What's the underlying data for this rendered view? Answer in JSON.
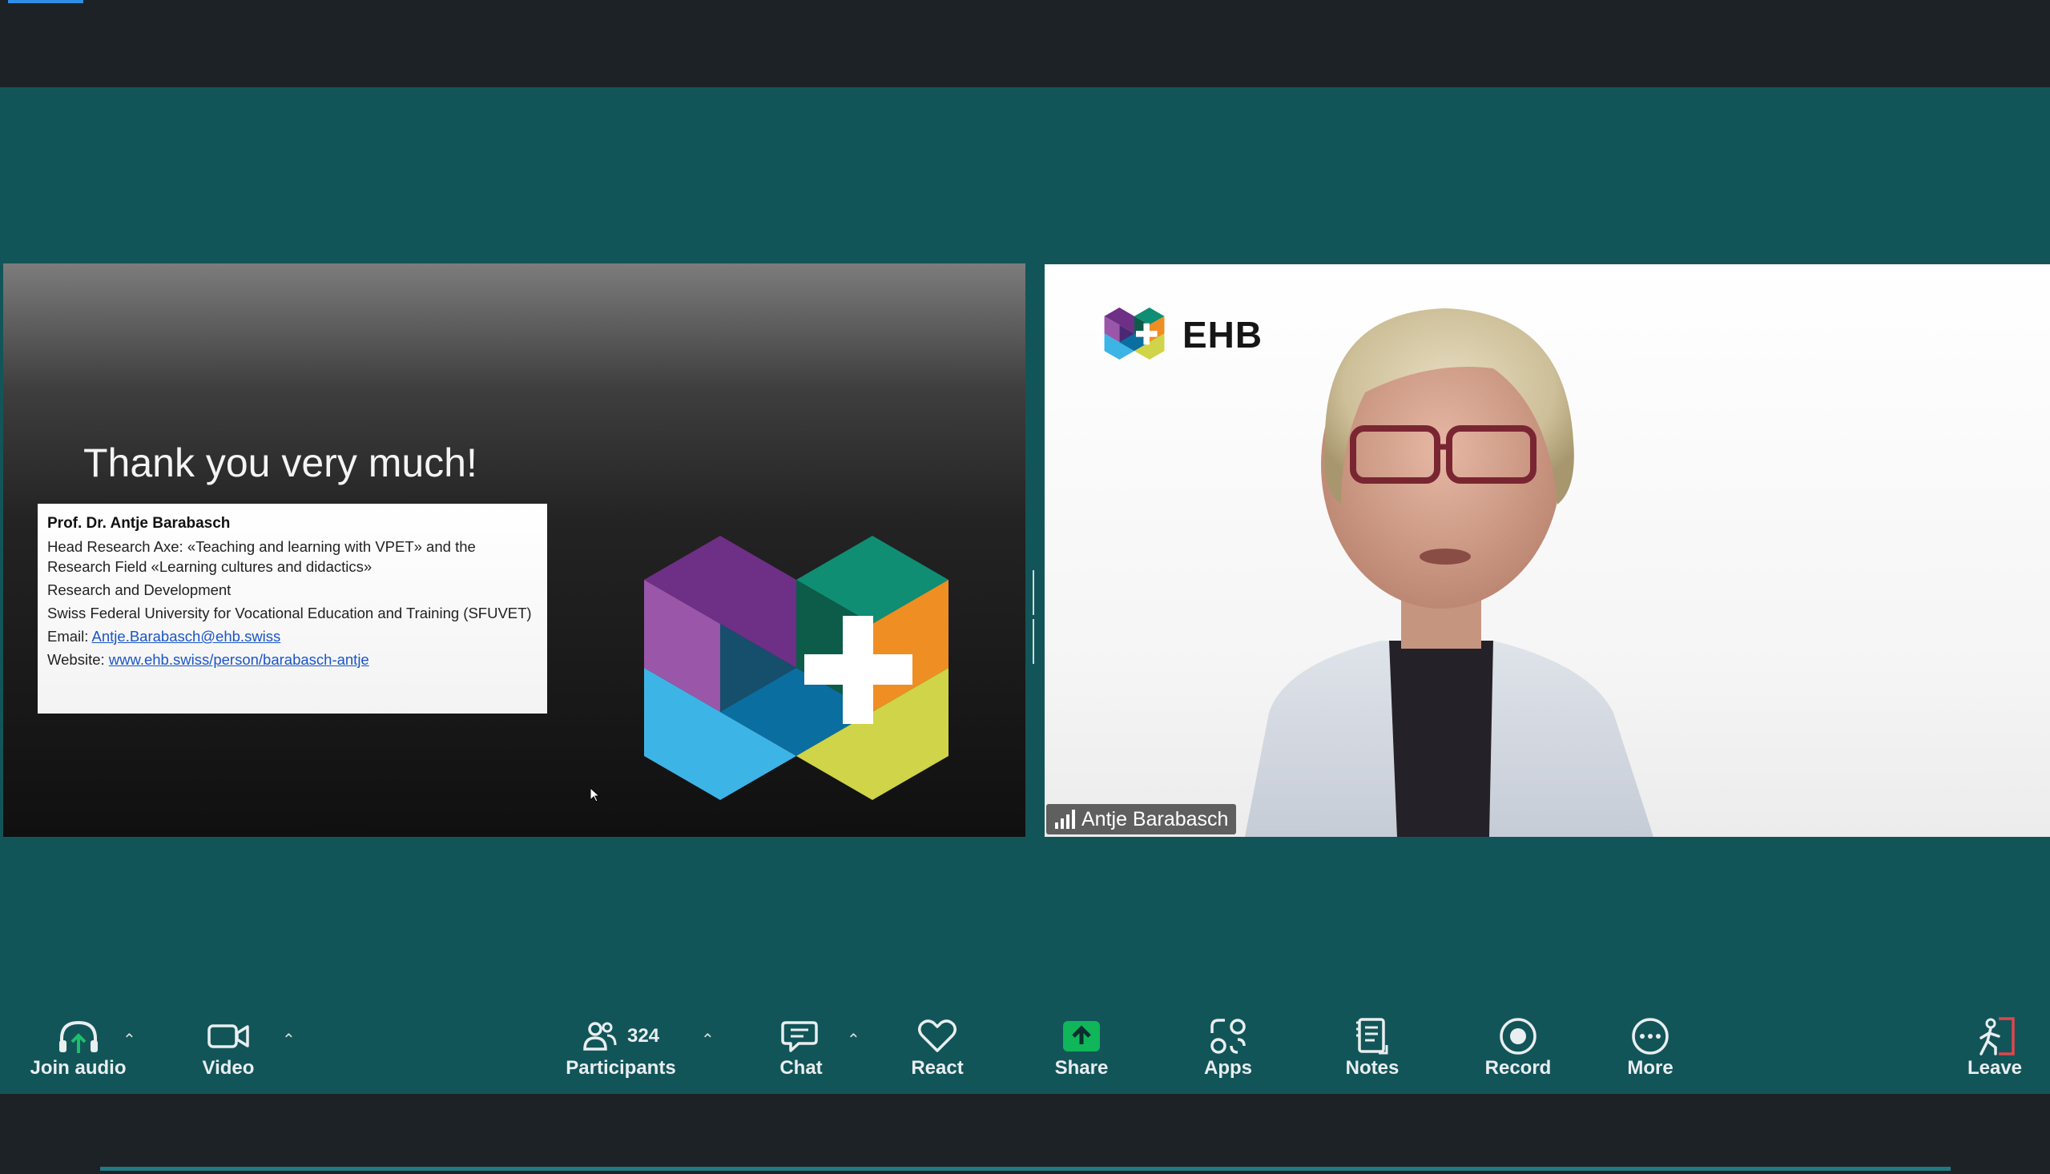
{
  "slide": {
    "title": "Thank you very much!",
    "name": "Prof. Dr. Antje Barabasch",
    "line1": "Head Research Axe: «Teaching and learning with VPET» and the Research Field «Learning cultures and didactics»",
    "line2": "Research and Development",
    "line3": "Swiss Federal University for Vocational Education and Training (SFUVET)",
    "email_label": "Email:",
    "email": "Antje.Barabasch@ehb.swiss",
    "website_label": "Website:",
    "website": "www.ehb.swiss/person/barabasch-antje"
  },
  "video": {
    "logo_text": "EHB",
    "participant_name": "Antje Barabasch"
  },
  "toolbar": {
    "join_audio": "Join audio",
    "video": "Video",
    "participants": "Participants",
    "participants_count": "324",
    "chat": "Chat",
    "react": "React",
    "share": "Share",
    "apps": "Apps",
    "notes": "Notes",
    "record": "Record",
    "more": "More",
    "leave": "Leave"
  },
  "colors": {
    "stage_bg": "#125559",
    "topbar_bg": "#1d2226",
    "share_green": "#0fb65a",
    "leave_red": "#e0464a"
  }
}
